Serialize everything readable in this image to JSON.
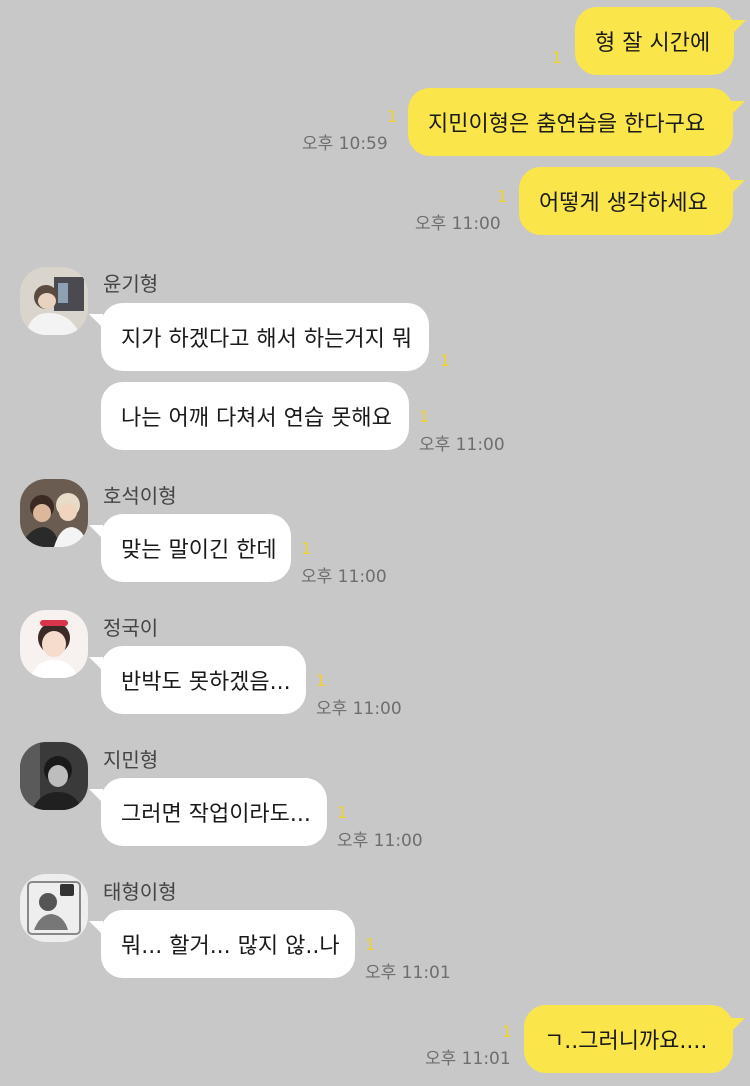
{
  "messages": {
    "m1": {
      "text": "형 잘 시간에",
      "unread": "1"
    },
    "m2": {
      "text": "지민이형은 춤연습을 한다구요",
      "unread": "1",
      "time": "오후 10:59"
    },
    "m3": {
      "text": "어떻게 생각하세요",
      "unread": "1",
      "time": "오후 11:00"
    },
    "yoongi": {
      "name": "윤기형",
      "msg1": {
        "text": "지가 하겠다고 해서 하는거지 뭐",
        "unread": "1"
      },
      "msg2": {
        "text": "나는 어깨 다쳐서 연습 못해요",
        "unread": "1",
        "time": "오후 11:00"
      }
    },
    "hoseok": {
      "name": "호석이형",
      "text": "맞는 말이긴 한데",
      "unread": "1",
      "time": "오후 11:00"
    },
    "jungkook": {
      "name": "정국이",
      "text": "반박도 못하겠음...",
      "unread": "1",
      "time": "오후 11:00"
    },
    "jimin": {
      "name": "지민형",
      "text": "그러면 작업이라도...",
      "unread": "1",
      "time": "오후 11:00"
    },
    "taehyung": {
      "name": "태형이형",
      "text": "뭐... 할거... 많지 않..나",
      "unread": "1",
      "time": "오후 11:01"
    },
    "m_last": {
      "text": "ㄱ..그러니까요....",
      "unread": "1",
      "time": "오후 11:01"
    }
  },
  "colors": {
    "background": "#c8c8c8",
    "my_bubble": "#fae64a",
    "their_bubble": "#ffffff",
    "unread": "#f2d22d"
  }
}
